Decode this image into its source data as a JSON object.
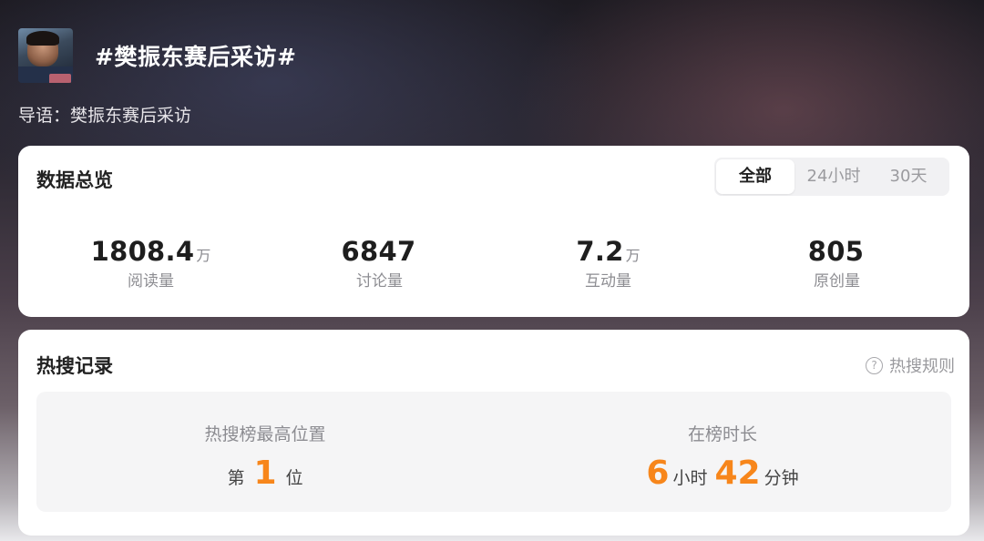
{
  "header": {
    "title": "#樊振东赛后采访#",
    "lead": "导语：樊振东赛后采访"
  },
  "overview": {
    "title": "数据总览",
    "tabs": [
      "全部",
      "24小时",
      "30天"
    ],
    "active_tab": "全部",
    "stats": [
      {
        "value": "1808.4",
        "unit": "万",
        "label": "阅读量"
      },
      {
        "value": "6847",
        "unit": "",
        "label": "讨论量"
      },
      {
        "value": "7.2",
        "unit": "万",
        "label": "互动量"
      },
      {
        "value": "805",
        "unit": "",
        "label": "原创量"
      }
    ]
  },
  "hot": {
    "title": "热搜记录",
    "rules_label": "热搜规则",
    "rules_icon": "help-circle-icon",
    "highest": {
      "label": "热搜榜最高位置",
      "prefix": "第",
      "rank": "1",
      "suffix": "位"
    },
    "duration": {
      "label": "在榜时长",
      "hours": "6",
      "hours_unit": "小时",
      "minutes": "42",
      "minutes_unit": "分钟"
    }
  },
  "colors": {
    "accent": "#f7861b",
    "card_bg": "#ffffff",
    "panel_bg": "#f5f5f6"
  }
}
